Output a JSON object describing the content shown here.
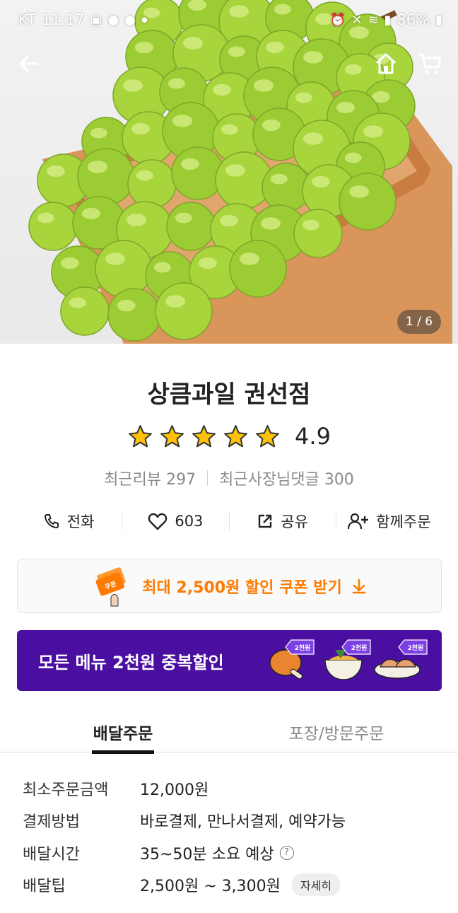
{
  "status_bar": {
    "carrier": "KT",
    "time": "11:17",
    "notification_icons": [
      "gallery-icon",
      "talk-icon",
      "message-icon",
      "dot-icon"
    ],
    "battery": "86%"
  },
  "hero": {
    "image_alt": "shine-muscat-grapes-photo",
    "pager": "1 / 6"
  },
  "store": {
    "name": "상큼과일 권선점",
    "rating": 4.9,
    "rating_text": "4.9",
    "stars_filled": 5,
    "recent_reviews": "최근리뷰 297",
    "owner_replies": "최근사장님댓글 300"
  },
  "actions": {
    "call_label": "전화",
    "like_count": "603",
    "share_label": "공유",
    "group_order_label": "함께주문"
  },
  "coupon": {
    "badge_text": "쿠폰",
    "label": "최대 2,500원 할인 쿠폰 받기"
  },
  "promo": {
    "text": "모든 메뉴 2천원 중복할인",
    "badge": "2천원"
  },
  "tabs": {
    "delivery": "배달주문",
    "pickup": "포장/방문주문"
  },
  "info": {
    "min_order_label": "최소주문금액",
    "min_order_value": "12,000원",
    "payment_label": "결제방법",
    "payment_value": "바로결제, 만나서결제, 예약가능",
    "delivery_time_label": "배달시간",
    "delivery_time_value": "35~50분 소요 예상",
    "help_glyph": "?",
    "delivery_tip_label": "배달팁",
    "delivery_tip_value": "2,500원 ~ 3,300원",
    "detail_label": "자세히"
  },
  "colors": {
    "accent_orange": "#ff7a00",
    "promo_purple": "#4a0fa0",
    "star_yellow": "#ffc107"
  }
}
